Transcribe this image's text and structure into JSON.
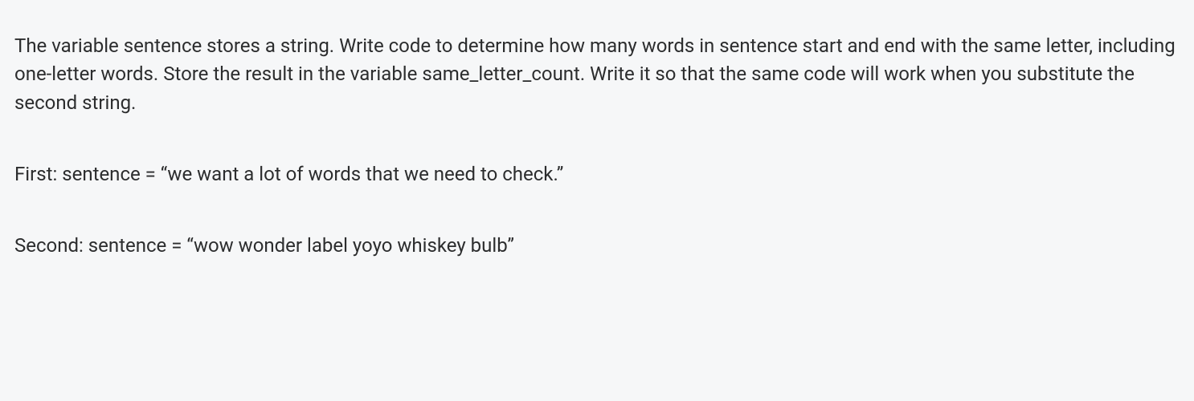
{
  "question": {
    "prompt": "The variable sentence stores a string. Write code to determine how many words in sentence start and end with the same letter, including one-letter words. Store the result in the variable same_letter_count. Write it so that the same code will work when you substitute the second string.",
    "examples": {
      "first": "First: sentence = “we want a lot of words that we need to check.”",
      "second": "Second: sentence = “wow wonder label yoyo whiskey bulb”"
    }
  }
}
